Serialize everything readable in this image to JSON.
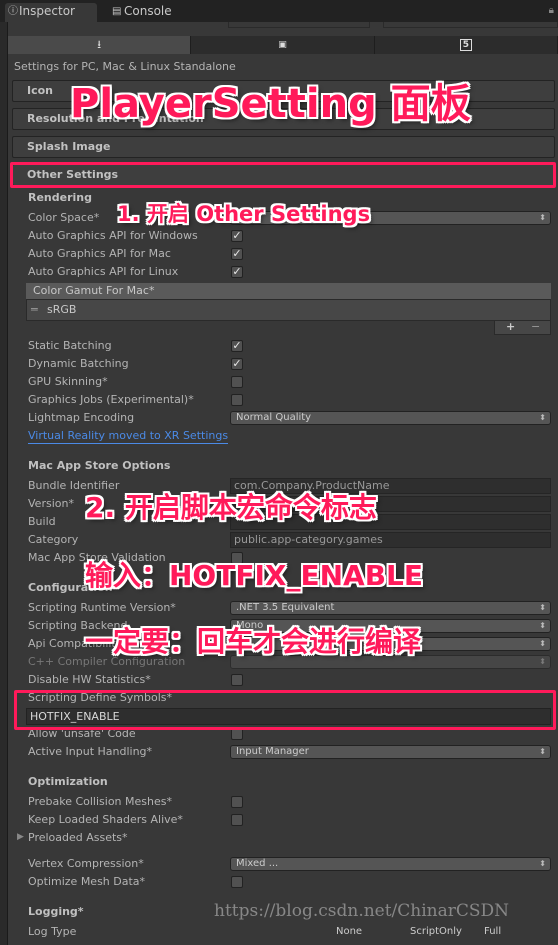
{
  "window": {
    "tabs": [
      {
        "label": "Inspector",
        "icon": "info-icon",
        "active": true
      },
      {
        "label": "Console",
        "icon": "console-icon",
        "active": false
      }
    ]
  },
  "platforms": [
    {
      "icon": "standalone-download-icon",
      "selected": true
    },
    {
      "icon": "android-icon",
      "selected": false
    },
    {
      "icon": "html5-icon",
      "selected": false
    }
  ],
  "settings_for": "Settings for PC, Mac & Linux Standalone",
  "section_headers": [
    "Icon",
    "Resolution and Presentation",
    "Splash Image",
    "Other Settings"
  ],
  "color_gamut": {
    "header": "Color Gamut For Mac*",
    "items": [
      "sRGB"
    ],
    "add": "+",
    "remove": "−"
  },
  "define_symbols_value": "HOTFIX_ENABLE",
  "rows": [
    {
      "kind": "heading",
      "label": "Rendering"
    },
    {
      "kind": "dropdown",
      "label": "Color Space*",
      "value": ""
    },
    {
      "kind": "checkbox",
      "label": "Auto Graphics API  for Windows",
      "checked": true
    },
    {
      "kind": "checkbox",
      "label": "Auto Graphics API  for Mac",
      "checked": true
    },
    {
      "kind": "checkbox",
      "label": "Auto Graphics API  for Linux",
      "checked": true
    },
    {
      "kind": "checkbox",
      "label": "Static Batching",
      "checked": true
    },
    {
      "kind": "checkbox",
      "label": "Dynamic Batching",
      "checked": true
    },
    {
      "kind": "checkbox",
      "label": "GPU Skinning*",
      "checked": false
    },
    {
      "kind": "checkbox",
      "label": "Graphics Jobs (Experimental)*",
      "checked": false
    },
    {
      "kind": "dropdown",
      "label": "Lightmap Encoding",
      "value": "Normal Quality"
    },
    {
      "kind": "link",
      "label": "Virtual Reality moved to XR Settings"
    },
    {
      "kind": "heading",
      "label": "Mac App Store Options"
    },
    {
      "kind": "text",
      "label": "Bundle Identifier",
      "value": "com.Company.ProductName"
    },
    {
      "kind": "text",
      "label": "Version*",
      "value": ""
    },
    {
      "kind": "text",
      "label": "Build",
      "value": ""
    },
    {
      "kind": "text",
      "label": "Category",
      "value": "public.app-category.games"
    },
    {
      "kind": "checkbox",
      "label": "Mac App Store Validation",
      "checked": false
    },
    {
      "kind": "heading",
      "label": "Configuration"
    },
    {
      "kind": "dropdown",
      "label": "Scripting Runtime Version*",
      "value": ".NET 3.5 Equivalent"
    },
    {
      "kind": "dropdown",
      "label": "Scripting Backend",
      "value": "Mono"
    },
    {
      "kind": "dropdown",
      "label": "Api Compatibility Level*",
      "value": ""
    },
    {
      "kind": "dropdown",
      "label": "C++ Compiler Configuration",
      "value": "",
      "disabled": true
    },
    {
      "kind": "checkbox",
      "label": "Disable HW Statistics*",
      "checked": false
    },
    {
      "kind": "label",
      "label": "Scripting Define Symbols*"
    },
    {
      "kind": "checkbox",
      "label": "Allow 'unsafe' Code",
      "checked": false
    },
    {
      "kind": "dropdown",
      "label": "Active Input Handling*",
      "value": "Input Manager"
    },
    {
      "kind": "heading",
      "label": "Optimization"
    },
    {
      "kind": "checkbox",
      "label": "Prebake Collision Meshes*",
      "checked": false
    },
    {
      "kind": "checkbox",
      "label": "Keep Loaded Shaders Alive*",
      "checked": false
    },
    {
      "kind": "foldout",
      "label": "Preloaded Assets*"
    },
    {
      "kind": "dropdown",
      "label": "Vertex Compression*",
      "value": "Mixed ..."
    },
    {
      "kind": "checkbox",
      "label": "Optimize Mesh Data*",
      "checked": false
    },
    {
      "kind": "heading",
      "label": "Logging*"
    },
    {
      "kind": "logtype",
      "label": "Log Type",
      "columns": [
        "None",
        "ScriptOnly",
        "Full"
      ]
    }
  ],
  "annotations": {
    "title": "PlayerSetting 面板",
    "step1": "1. 开启 Other Settings",
    "step2": "2. 开启脚本宏命令标志",
    "input_hint": "输入：HOTFIX_ENABLE",
    "enter_hint": "一定要：回车才会进行编译",
    "color": "#ff1a5a"
  },
  "watermark": "https://blog.csdn.net/ChinarCSDN"
}
